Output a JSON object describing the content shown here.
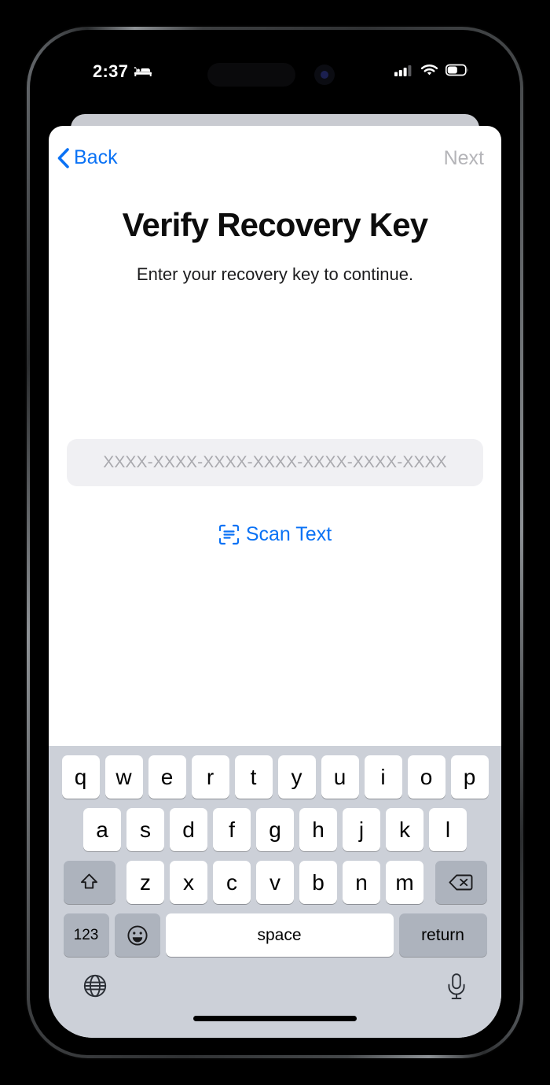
{
  "device": {
    "name": "iphone-15-pro",
    "side_buttons": [
      "action-button",
      "volume-up",
      "volume-down",
      "power-button"
    ]
  },
  "status_bar": {
    "time": "2:37",
    "focus_icon": "bed-icon",
    "cellular_icon": "cellular-bars-icon",
    "cellular_bars_filled": 3,
    "cellular_bars_total": 4,
    "wifi_icon": "wifi-icon",
    "battery_icon": "battery-icon",
    "battery_level_percent": 55
  },
  "nav_bar": {
    "back_label": "Back",
    "back_icon": "chevron-left-icon",
    "next_label": "Next",
    "next_enabled": false,
    "accent_color": "#0a72f5",
    "disabled_color": "#b4b4b8"
  },
  "content": {
    "title": "Verify Recovery Key",
    "subtitle": "Enter your recovery key to continue.",
    "recovery_key_field": {
      "value": "",
      "placeholder": "XXXX-XXXX-XXXX-XXXX-XXXX-XXXX-XXXX"
    },
    "scan_text": {
      "label": "Scan Text",
      "icon": "scan-text-icon"
    }
  },
  "keyboard": {
    "row1": [
      "q",
      "w",
      "e",
      "r",
      "t",
      "y",
      "u",
      "i",
      "o",
      "p"
    ],
    "row2": [
      "a",
      "s",
      "d",
      "f",
      "g",
      "h",
      "j",
      "k",
      "l"
    ],
    "row3": [
      "z",
      "x",
      "c",
      "v",
      "b",
      "n",
      "m"
    ],
    "shift_icon": "shift-icon",
    "delete_icon": "delete-backward-icon",
    "numbers_label": "123",
    "emoji_icon": "emoji-smiley-icon",
    "space_label": "space",
    "return_label": "return",
    "globe_icon": "globe-icon",
    "mic_icon": "microphone-icon",
    "background_color": "#ccd0d8",
    "key_color": "#ffffff",
    "modifier_key_color": "#adb3bd"
  }
}
